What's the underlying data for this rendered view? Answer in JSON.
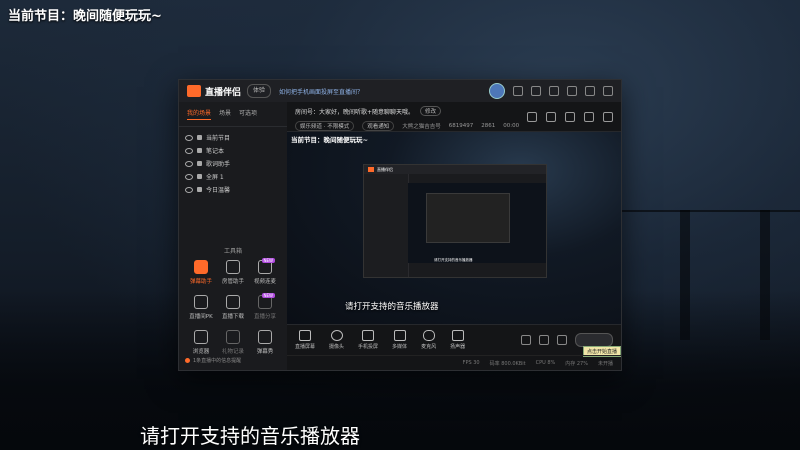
{
  "overlay": {
    "program_title": "当前节目：晚间随便玩玩~",
    "subtitle": "请打开支持的音乐播放器"
  },
  "app": {
    "name": "直播伴侣",
    "badge": "体验",
    "tip_link": "如何把手机画面投屏至直播间？",
    "window_controls": [
      "minimize-icon",
      "maximize-icon",
      "close-icon"
    ]
  },
  "sidebar": {
    "tabs": [
      {
        "label": "我的场景",
        "active": true
      },
      {
        "label": "场景",
        "active": false
      },
      {
        "label": "可选项",
        "active": false
      }
    ],
    "sources": [
      {
        "label": "当前节目"
      },
      {
        "label": "笔记本"
      },
      {
        "label": "歌词助手"
      },
      {
        "label": "全屏 1"
      },
      {
        "label": "今日温馨"
      }
    ],
    "tools_title": "工具箱",
    "tools": [
      {
        "label": "弹幕助手",
        "hot": true,
        "new": false
      },
      {
        "label": "房管助手",
        "hot": false,
        "new": false
      },
      {
        "label": "视频连麦",
        "hot": false,
        "new": true
      },
      {
        "label": "直播间PK",
        "hot": false,
        "new": false
      },
      {
        "label": "直播下载",
        "hot": false,
        "new": false
      },
      {
        "label": "直播分享",
        "hot": false,
        "new": true
      },
      {
        "label": "浏览器",
        "hot": false,
        "new": false
      },
      {
        "label": "礼物记录",
        "hot": false,
        "new": false
      },
      {
        "label": "弹幕秀",
        "hot": false,
        "new": false
      }
    ],
    "footer": "1条直播中的信息提醒"
  },
  "info": {
    "notice": "房间号：大家好，晚间听歌+随意聊聊天哦。",
    "modify_label": "修改",
    "meta": [
      "娱乐频道 · 不限模式",
      "观看通知",
      "大熊之猫吉吉号",
      "6819497",
      "2861",
      "00:00"
    ]
  },
  "preview": {
    "title": "当前节目：晚间随便玩玩~",
    "subtitle": "请打开支持的音乐播放器",
    "nested_app_name": "直播伴侣",
    "nested_caption": "请打开支持的音乐播放器"
  },
  "controls": [
    {
      "label": "直播屏幕",
      "icon": "screen-icon"
    },
    {
      "label": "摄像头",
      "icon": "camera-icon"
    },
    {
      "label": "手机投屏",
      "icon": "phone-icon"
    },
    {
      "label": "多媒体",
      "icon": "media-icon"
    },
    {
      "label": "麦克风",
      "icon": "mic-icon"
    },
    {
      "label": "扬声器",
      "icon": "speaker-icon"
    }
  ],
  "tooltip": "点击开始直播",
  "status": [
    "FPS 30",
    "码率 800.0KBit",
    "CPU 8%",
    "内存 27%",
    "未开播"
  ]
}
